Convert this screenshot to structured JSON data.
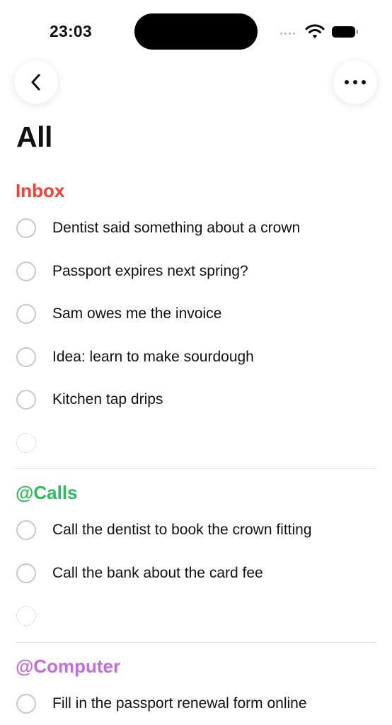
{
  "status_bar": {
    "time": "23:03"
  },
  "title": "All",
  "colors": {
    "inbox": "#ff3b30",
    "calls": "#2dbd5a",
    "computer": "#c56be0"
  },
  "sections": [
    {
      "name": "Inbox",
      "color": "#ff3b30",
      "items": [
        "Dentist said something about a crown",
        "Passport expires next spring?",
        "Sam owes me the invoice",
        "Idea: learn to make sourdough",
        "Kitchen tap drips"
      ]
    },
    {
      "name": "@Calls",
      "color": "#2dbd5a",
      "items": [
        "Call the dentist to book the crown fitting",
        "Call the bank about the card fee"
      ]
    },
    {
      "name": "@Computer",
      "color": "#c56be0",
      "items": [
        "Fill in the passport renewal form online"
      ]
    }
  ],
  "icons": {
    "back": "chevron-left-icon",
    "more": "ellipsis-icon",
    "wifi": "wifi-icon",
    "battery": "battery-icon"
  }
}
